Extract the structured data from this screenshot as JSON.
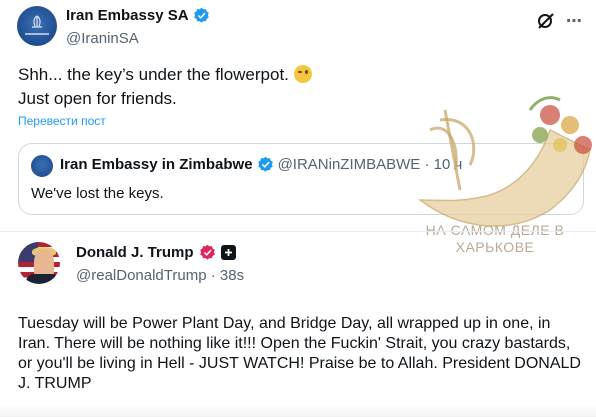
{
  "top_post": {
    "author_name": "Iran Embassy SA",
    "author_handle": "@IraninSA",
    "text_line1": "Shh... the key’s under the flowerpot.",
    "text_line2": "Just open for friends.",
    "translate_link": "Перевести пост"
  },
  "quote": {
    "author_name": "Iran Embassy in Zimbabwe",
    "author_handle": "@IRANinZIMBABWE · 10 ч",
    "text": "We've lost the keys."
  },
  "second_post": {
    "author_name": "Donald J. Trump",
    "author_handle": "@realDonaldTrump · 38s",
    "text": "Tuesday will be Power Plant Day, and Bridge Day, all wrapped up in one, in Iran. There will be nothing like it!!! Open the Fuckin' Strait, you crazy bastards, or you'll be living in Hell - JUST WATCH! Praise be to Allah. President DONALD J. TRUMP"
  },
  "watermark": {
    "line1": "НА САМОМ ДЕЛЕ В",
    "line2": "ХАРЬКОВЕ"
  },
  "icons": {
    "verified": "verified-blue-check-icon",
    "grok": "grok-icon",
    "more": "more-options-icon",
    "wink": "winking-face-emoji",
    "pink_badge": "verified-pink-badge-icon",
    "affiliate": "affiliate-square-icon",
    "cornucopia": "cornucopia-caduceus-icon"
  },
  "colors": {
    "accent": "#1d9bf0",
    "secondary_text": "#536471",
    "watermark": "#b9a995"
  }
}
